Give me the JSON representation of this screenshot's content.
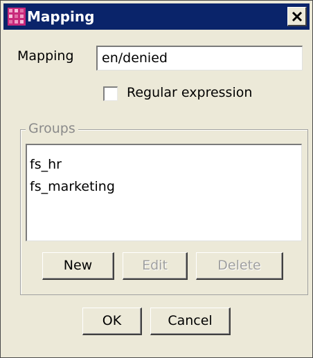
{
  "window": {
    "title": "Mapping",
    "icon": "app-icon",
    "close_icon": "close-icon"
  },
  "form": {
    "mapping_label": "Mapping",
    "mapping_value": "en/denied",
    "regex_label": "Regular expression",
    "regex_checked": false
  },
  "groups": {
    "legend": "Groups",
    "items": [
      "fs_hr",
      "fs_marketing"
    ],
    "new_label": "New",
    "edit_label": "Edit",
    "delete_label": "Delete"
  },
  "footer": {
    "ok_label": "OK",
    "cancel_label": "Cancel"
  },
  "colors": {
    "titlebar": "#0a246a",
    "window_bg": "#ece9d8",
    "disabled_text": "#a0a0a0"
  }
}
